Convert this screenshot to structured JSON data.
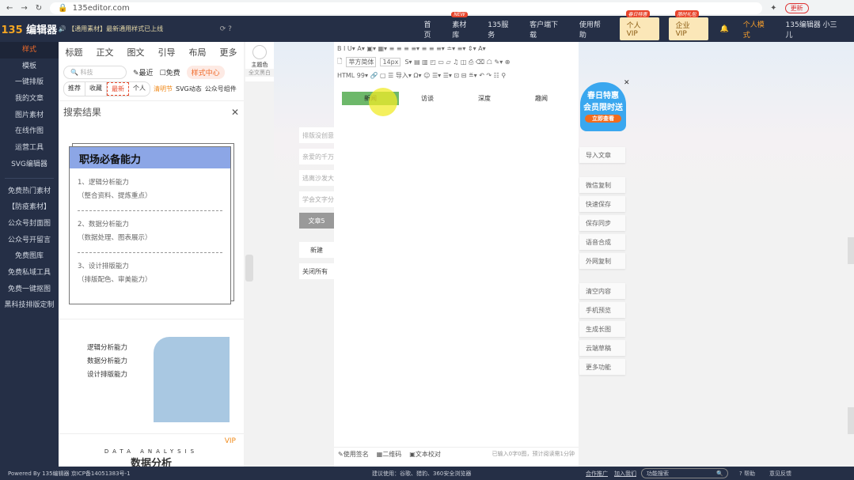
{
  "browser": {
    "url": "135editor.com",
    "update_label": "更新"
  },
  "header": {
    "logo_num": "135",
    "logo_text": "编辑器",
    "notice": "【通用素材】最新通用样式已上线",
    "nav": [
      {
        "label": "首页"
      },
      {
        "label": "素材库",
        "tag": "NEW"
      },
      {
        "label": "135服务"
      },
      {
        "label": "客户端下载"
      },
      {
        "label": "使用帮助"
      }
    ],
    "vip_personal": "个人VIP",
    "vip_personal_tag": "春日特惠",
    "vip_enterprise": "企业VIP",
    "vip_enterprise_tag": "限时礼包",
    "mode": "个人模式",
    "user": "135编辑器 小三儿"
  },
  "sidebar": {
    "items": [
      "样式",
      "模板",
      "一键排版",
      "我的文章",
      "图片素材",
      "在线作图",
      "运营工具",
      "SVG编辑器"
    ],
    "items2": [
      "免费热门素材",
      "【防疫素材】",
      "公众号封面图",
      "公众号开留言",
      "免费图库",
      "免费私域工具",
      "免费一键抠图",
      "黑科技排版定制"
    ]
  },
  "panel": {
    "tabs": [
      "标题",
      "正文",
      "图文",
      "引导",
      "布局",
      "更多"
    ],
    "search_placeholder": "科技",
    "recent": "最近",
    "free": "免费",
    "style_center": "样式中心",
    "filters": [
      "推荐",
      "收藏",
      "最新",
      "个人"
    ],
    "tag_festival": "清明节",
    "tag_svg": "SVG动态",
    "tag_component": "公众号组件",
    "results_title": "搜索结果",
    "card": {
      "title": "职场必备能力",
      "items": [
        [
          "1、逻辑分析能力",
          "（整合资料、提炼重点）"
        ],
        [
          "2、数据分析能力",
          "（数据处理、图表展示）"
        ],
        [
          "3、设计排版能力",
          "（排版配色、审美能力）"
        ]
      ]
    },
    "card2": [
      "逻辑分析能力",
      "数据分析能力",
      "设计排版能力"
    ],
    "card3": {
      "sub": "DATA ANALYSIS",
      "title": "数据分析",
      "vip": "VIP"
    }
  },
  "theme": {
    "label": "主题色",
    "sub": "全文黑白"
  },
  "articles": [
    "排版没创意",
    "亲爱的千万",
    "逃离沙发大",
    "学会文字分",
    "文章5"
  ],
  "article_actions": {
    "new": "新建",
    "close_all": "关闭所有"
  },
  "editor": {
    "toolbar1": "B  I  U▾  A▾  ▣▾  ▦▾  ≡  ≡  ≡  ≡▾  ≡  ≡  ≡▾  ≐▾  ≡▾  ⇕▾  A▾",
    "font": "苹方简体",
    "size": "14px",
    "toolbar2": "S▾  ▤  ▥  ◰  ▭  ▱  ♫  ◫  ⎙  ⌫  ☖  ✎▾  ⊕",
    "toolbar3": "HTML  99▾  🔗  ▢  ☰ 导入▾  Ω▾  ☺  ☰▾  ☰▾  ⊡  ⊟  ≝▾  ↶  ↷  ☷  ⚲",
    "tabs": [
      "新闻",
      "访谈",
      "深度",
      "趣闻"
    ],
    "sign": "使用签名",
    "qrcode": "二维码",
    "proofread": "文本校对",
    "count": "已输入0字0图，预计阅读需1分钟"
  },
  "promo": {
    "line1": "春日特惠",
    "line2": "会员限时送",
    "line3": "立即查看"
  },
  "right_actions": {
    "g1": [
      "导入文章"
    ],
    "g2": [
      "微信复制",
      "快速保存",
      "保存同步",
      "语音合成",
      "外网复制"
    ],
    "g3": [
      "清空内容",
      "手机预览",
      "生成长图",
      "云端草稿",
      "更多功能"
    ]
  },
  "footer": {
    "powered": "Powered By 135编辑器  京ICP备14051383号-1",
    "suggest": "建议使用：谷歌、猎豹、360安全浏览器",
    "coop": "合作推广",
    "join": "加入我们",
    "search_placeholder": "功能搜索",
    "help": "? 帮助",
    "feedback": "意见反馈"
  },
  "colors": {
    "header_bg": "#252f46",
    "accent": "#f06b2a",
    "green_tab": "#6db86a",
    "card_head": "#8ca6e6"
  }
}
